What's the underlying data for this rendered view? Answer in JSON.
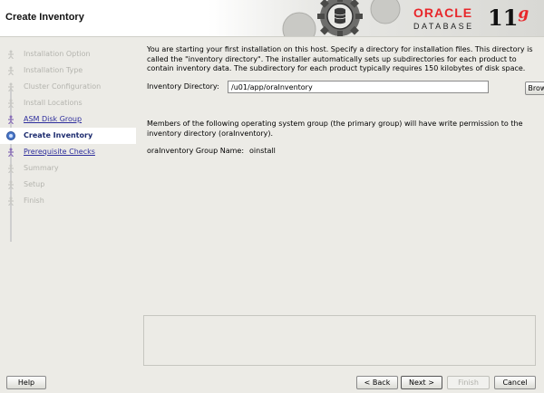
{
  "header": {
    "title": "Create Inventory",
    "brand": "ORACLE",
    "product": "DATABASE",
    "version": "11",
    "version_suffix": "g"
  },
  "steps": [
    {
      "label": "Installation Option",
      "state": "pending"
    },
    {
      "label": "Installation Type",
      "state": "pending"
    },
    {
      "label": "Cluster Configuration",
      "state": "pending"
    },
    {
      "label": "Install Locations",
      "state": "pending"
    },
    {
      "label": "ASM Disk Group",
      "state": "link"
    },
    {
      "label": "Create Inventory",
      "state": "current"
    },
    {
      "label": "Prerequisite Checks",
      "state": "link"
    },
    {
      "label": "Summary",
      "state": "pending"
    },
    {
      "label": "Setup",
      "state": "pending"
    },
    {
      "label": "Finish",
      "state": "pending"
    }
  ],
  "content": {
    "description": "You are starting your first installation on this host. Specify a directory for installation files. This directory is called the \"inventory directory\". The installer automatically sets up subdirectories for each product to contain inventory data. The subdirectory for each product typically requires 150 kilobytes of disk space.",
    "inventory_label": "Inventory Directory:",
    "inventory_value": "/u01/app/oraInventory",
    "browse_label": "Browse",
    "members_text": "Members of the following operating system group (the primary group) will have write permission to the inventory directory (oraInventory).",
    "group_label": "oraInventory Group Name:",
    "group_value": "oinstall"
  },
  "footer": {
    "help": "Help",
    "back": "< Back",
    "next": "Next >",
    "finish": "Finish",
    "cancel": "Cancel"
  },
  "colors": {
    "accent": "#e8262a",
    "link": "#2d2d9c",
    "current_text": "#1b2a6e",
    "background": "#ecebe6"
  }
}
